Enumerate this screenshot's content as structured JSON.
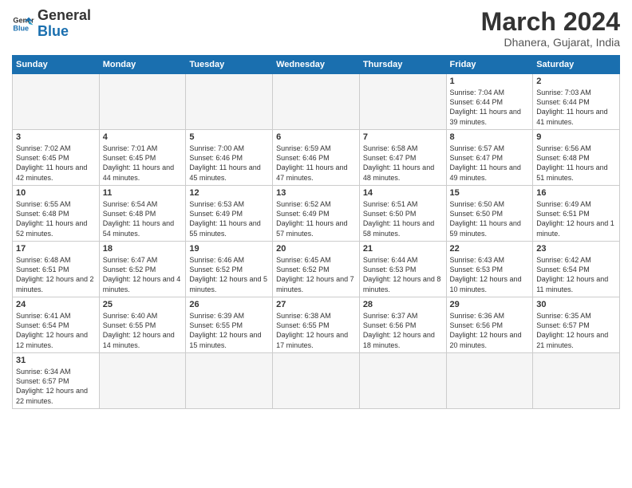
{
  "logo": {
    "line1": "General",
    "line2": "Blue"
  },
  "title": "March 2024",
  "subtitle": "Dhanera, Gujarat, India",
  "weekdays": [
    "Sunday",
    "Monday",
    "Tuesday",
    "Wednesday",
    "Thursday",
    "Friday",
    "Saturday"
  ],
  "weeks": [
    [
      {
        "day": "",
        "info": ""
      },
      {
        "day": "",
        "info": ""
      },
      {
        "day": "",
        "info": ""
      },
      {
        "day": "",
        "info": ""
      },
      {
        "day": "",
        "info": ""
      },
      {
        "day": "1",
        "info": "Sunrise: 7:04 AM\nSunset: 6:44 PM\nDaylight: 11 hours and 39 minutes."
      },
      {
        "day": "2",
        "info": "Sunrise: 7:03 AM\nSunset: 6:44 PM\nDaylight: 11 hours and 41 minutes."
      }
    ],
    [
      {
        "day": "3",
        "info": "Sunrise: 7:02 AM\nSunset: 6:45 PM\nDaylight: 11 hours and 42 minutes."
      },
      {
        "day": "4",
        "info": "Sunrise: 7:01 AM\nSunset: 6:45 PM\nDaylight: 11 hours and 44 minutes."
      },
      {
        "day": "5",
        "info": "Sunrise: 7:00 AM\nSunset: 6:46 PM\nDaylight: 11 hours and 45 minutes."
      },
      {
        "day": "6",
        "info": "Sunrise: 6:59 AM\nSunset: 6:46 PM\nDaylight: 11 hours and 47 minutes."
      },
      {
        "day": "7",
        "info": "Sunrise: 6:58 AM\nSunset: 6:47 PM\nDaylight: 11 hours and 48 minutes."
      },
      {
        "day": "8",
        "info": "Sunrise: 6:57 AM\nSunset: 6:47 PM\nDaylight: 11 hours and 49 minutes."
      },
      {
        "day": "9",
        "info": "Sunrise: 6:56 AM\nSunset: 6:48 PM\nDaylight: 11 hours and 51 minutes."
      }
    ],
    [
      {
        "day": "10",
        "info": "Sunrise: 6:55 AM\nSunset: 6:48 PM\nDaylight: 11 hours and 52 minutes."
      },
      {
        "day": "11",
        "info": "Sunrise: 6:54 AM\nSunset: 6:48 PM\nDaylight: 11 hours and 54 minutes."
      },
      {
        "day": "12",
        "info": "Sunrise: 6:53 AM\nSunset: 6:49 PM\nDaylight: 11 hours and 55 minutes."
      },
      {
        "day": "13",
        "info": "Sunrise: 6:52 AM\nSunset: 6:49 PM\nDaylight: 11 hours and 57 minutes."
      },
      {
        "day": "14",
        "info": "Sunrise: 6:51 AM\nSunset: 6:50 PM\nDaylight: 11 hours and 58 minutes."
      },
      {
        "day": "15",
        "info": "Sunrise: 6:50 AM\nSunset: 6:50 PM\nDaylight: 11 hours and 59 minutes."
      },
      {
        "day": "16",
        "info": "Sunrise: 6:49 AM\nSunset: 6:51 PM\nDaylight: 12 hours and 1 minute."
      }
    ],
    [
      {
        "day": "17",
        "info": "Sunrise: 6:48 AM\nSunset: 6:51 PM\nDaylight: 12 hours and 2 minutes."
      },
      {
        "day": "18",
        "info": "Sunrise: 6:47 AM\nSunset: 6:52 PM\nDaylight: 12 hours and 4 minutes."
      },
      {
        "day": "19",
        "info": "Sunrise: 6:46 AM\nSunset: 6:52 PM\nDaylight: 12 hours and 5 minutes."
      },
      {
        "day": "20",
        "info": "Sunrise: 6:45 AM\nSunset: 6:52 PM\nDaylight: 12 hours and 7 minutes."
      },
      {
        "day": "21",
        "info": "Sunrise: 6:44 AM\nSunset: 6:53 PM\nDaylight: 12 hours and 8 minutes."
      },
      {
        "day": "22",
        "info": "Sunrise: 6:43 AM\nSunset: 6:53 PM\nDaylight: 12 hours and 10 minutes."
      },
      {
        "day": "23",
        "info": "Sunrise: 6:42 AM\nSunset: 6:54 PM\nDaylight: 12 hours and 11 minutes."
      }
    ],
    [
      {
        "day": "24",
        "info": "Sunrise: 6:41 AM\nSunset: 6:54 PM\nDaylight: 12 hours and 12 minutes."
      },
      {
        "day": "25",
        "info": "Sunrise: 6:40 AM\nSunset: 6:55 PM\nDaylight: 12 hours and 14 minutes."
      },
      {
        "day": "26",
        "info": "Sunrise: 6:39 AM\nSunset: 6:55 PM\nDaylight: 12 hours and 15 minutes."
      },
      {
        "day": "27",
        "info": "Sunrise: 6:38 AM\nSunset: 6:55 PM\nDaylight: 12 hours and 17 minutes."
      },
      {
        "day": "28",
        "info": "Sunrise: 6:37 AM\nSunset: 6:56 PM\nDaylight: 12 hours and 18 minutes."
      },
      {
        "day": "29",
        "info": "Sunrise: 6:36 AM\nSunset: 6:56 PM\nDaylight: 12 hours and 20 minutes."
      },
      {
        "day": "30",
        "info": "Sunrise: 6:35 AM\nSunset: 6:57 PM\nDaylight: 12 hours and 21 minutes."
      }
    ],
    [
      {
        "day": "31",
        "info": "Sunrise: 6:34 AM\nSunset: 6:57 PM\nDaylight: 12 hours and 22 minutes."
      },
      {
        "day": "",
        "info": ""
      },
      {
        "day": "",
        "info": ""
      },
      {
        "day": "",
        "info": ""
      },
      {
        "day": "",
        "info": ""
      },
      {
        "day": "",
        "info": ""
      },
      {
        "day": "",
        "info": ""
      }
    ]
  ]
}
